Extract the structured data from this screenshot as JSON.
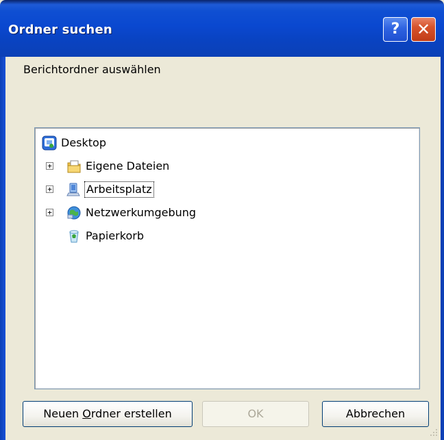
{
  "window": {
    "title": "Ordner suchen",
    "help_label": "?",
    "close_label": "✕"
  },
  "instruction": "Berichtordner auswählen",
  "tree": {
    "root": {
      "label": "Desktop",
      "icon": "desktop-icon"
    },
    "items": [
      {
        "label": "Eigene Dateien",
        "icon": "my-documents-icon",
        "expander": "+",
        "selected": false
      },
      {
        "label": "Arbeitsplatz",
        "icon": "my-computer-icon",
        "expander": "+",
        "selected": true
      },
      {
        "label": "Netzwerkumgebung",
        "icon": "network-icon",
        "expander": "+",
        "selected": false
      },
      {
        "label": "Papierkorb",
        "icon": "recycle-bin-icon",
        "expander": "",
        "selected": false
      }
    ]
  },
  "buttons": {
    "new_folder_pre": "Neuen ",
    "new_folder_mnemonic": "O",
    "new_folder_post": "rdner erstellen",
    "ok": "OK",
    "cancel": "Abbrechen"
  },
  "colors": {
    "title_bar": "#0b48d0",
    "window_bg": "#ece9d8",
    "close_button": "#d6532c",
    "help_button": "#2f63e1"
  }
}
